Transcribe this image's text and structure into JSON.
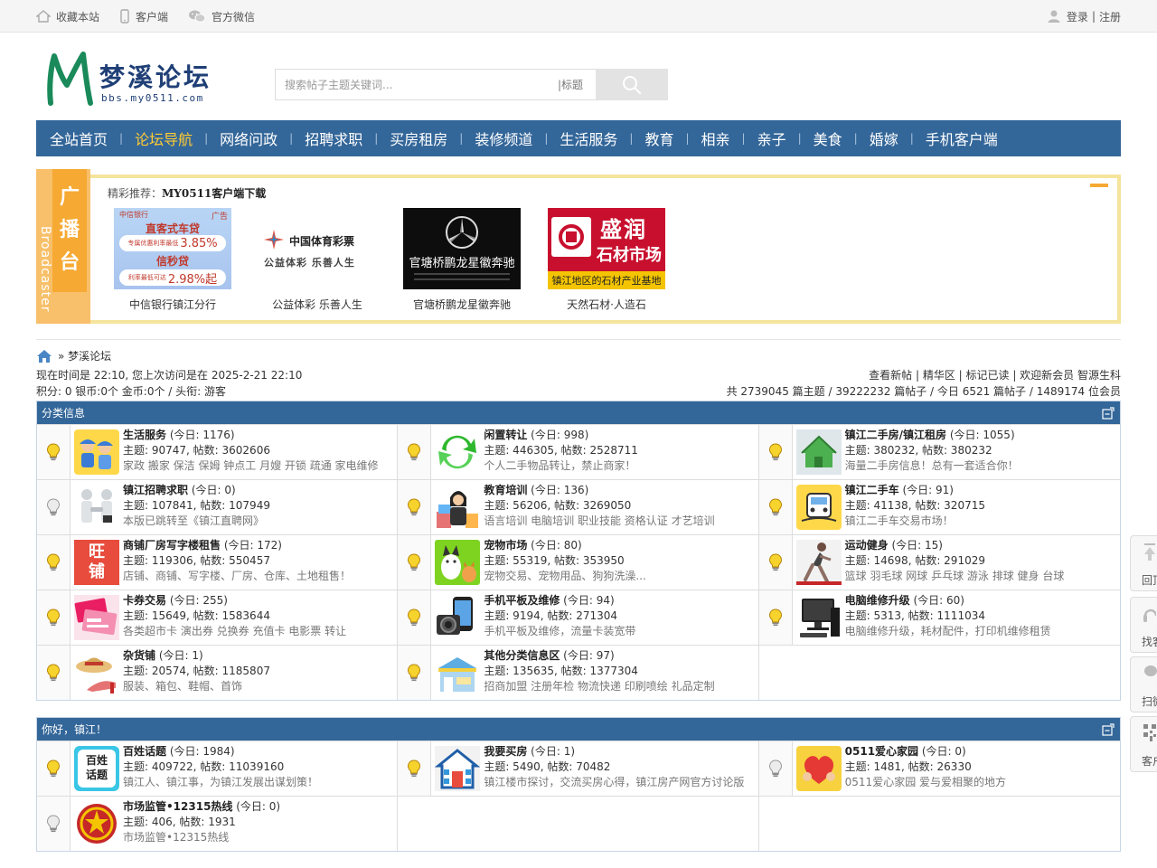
{
  "topbar": {
    "favorite": "收藏本站",
    "client": "客户端",
    "wechat": "官方微信",
    "login": "登录",
    "sep": "|",
    "register": "注册"
  },
  "header": {
    "logo_title": "梦溪论坛",
    "logo_sub": "bbs.my0511.com",
    "search_placeholder": "搜索帖子主题关键词...",
    "search_type": "|标题"
  },
  "nav": {
    "items": [
      "全站首页",
      "论坛导航",
      "网络问政",
      "招聘求职",
      "买房租房",
      "装修频道",
      "生活服务",
      "教育",
      "相亲",
      "亲子",
      "美食",
      "婚嫁",
      "手机客户端"
    ],
    "sep": "|"
  },
  "broadcaster": {
    "tab": [
      "广",
      "播",
      "台"
    ],
    "tab_vertical": "Broadcaster",
    "label": "精彩推荐：",
    "title": "MY0511客户端下载",
    "cards": [
      {
        "caption": "中信银行镇江分行",
        "bank": "中信银行",
        "tag": "广告",
        "line1": "直客式车贷",
        "line2a": "专属优惠利率最低",
        "line2b": "3.85%",
        "line3": "信秒贷",
        "line4a": "利率最低可达",
        "line4b": "2.98%起"
      },
      {
        "caption": "公益体彩 乐善人生",
        "name": "中国体育彩票",
        "slogan": "公益体彩 乐善人生"
      },
      {
        "caption": "官塘桥鹏龙星徽奔驰",
        "name": "官塘桥鹏龙星徽奔驰"
      },
      {
        "caption": "天然石材·人造石",
        "name1": "盛润",
        "name2": "石材市场",
        "banner": "镇江地区的石材产业基地"
      }
    ]
  },
  "breadcrumb": {
    "text": "» 梦溪论坛"
  },
  "info": {
    "line1_left": "现在时间是 22:10, 您上次访问是在 2025-2-21 22:10",
    "line2_left": "积分: 0 银币:0个 金币:0个 / 头衔: 游客",
    "line1_right": "查看新帖 | 精华区 | 标记已读 | 欢迎新会员 智源生科",
    "line2_right": "共 2739045 篇主题 / 39222232 篇帖子 / 今日 6521 篇帖子 / 1489174 位会员"
  },
  "sections": [
    {
      "title": "分类信息",
      "rows": [
        [
          {
            "name": "生活服务",
            "today": " (今日: 1176)",
            "stat": "主题: 90747, 帖数: 3602606",
            "desc": "家政 搬家 保洁 保姆 钟点工 月嫂 开锁 疏通 家电维修",
            "icon": "workers-icon",
            "new": true
          },
          {
            "name": "闲置转让",
            "today": " (今日: 998)",
            "stat": "主题: 446305, 帖数: 2528711",
            "desc": "个人二手物品转让，禁止商家！",
            "icon": "recycle-icon",
            "new": true
          },
          {
            "name": "镇江二手房/镇江租房",
            "today": " (今日: 1055)",
            "stat": "主题: 380232, 帖数: 380232",
            "desc": "海量二手房信息！总有一套适合你！",
            "icon": "green-house-icon",
            "new": true
          }
        ],
        [
          {
            "name": "镇江招聘求职",
            "today": " (今日: 0)",
            "stat": "主题: 107841, 帖数: 107949",
            "desc": "本版已跳转至《镇江直聘网》",
            "icon": "handshake-icon",
            "new": false
          },
          {
            "name": "教育培训",
            "today": " (今日: 136)",
            "stat": "主题: 56206, 帖数: 3269050",
            "desc": "语言培训 电脑培训 职业技能 资格认证 才艺培训",
            "icon": "teacher-icon",
            "new": true
          },
          {
            "name": "镇江二手车",
            "today": " (今日: 91)",
            "stat": "主题: 41138, 帖数: 320715",
            "desc": "镇江二手车交易市场！",
            "icon": "car-icon",
            "new": true
          }
        ],
        [
          {
            "name": "商铺厂房写字楼租售",
            "today": " (今日: 172)",
            "stat": "主题: 119306, 帖数: 550457",
            "desc": "店铺、商铺、写字楼、厂房、仓库、土地租售！",
            "icon": "shop-icon",
            "new": true,
            "icon_text": [
              "旺",
              "铺"
            ]
          },
          {
            "name": "宠物市场",
            "today": " (今日: 80)",
            "stat": "主题: 55319, 帖数: 353950",
            "desc": "宠物交易、宠物用品、狗狗洗澡...",
            "icon": "pets-icon",
            "new": true
          },
          {
            "name": "运动健身",
            "today": " (今日: 15)",
            "stat": "主题: 14698, 帖数: 291029",
            "desc": "篮球 羽毛球 网球 乒乓球 游泳 排球 健身 台球",
            "icon": "runner-icon",
            "new": true
          }
        ],
        [
          {
            "name": "卡券交易",
            "today": " (今日: 255)",
            "stat": "主题: 15649, 帖数: 1583644",
            "desc": "各类超市卡 演出券 兑换券 充值卡 电影票 转让",
            "icon": "coupon-icon",
            "new": true
          },
          {
            "name": "手机平板及维修",
            "today": " (今日: 94)",
            "stat": "主题: 9194, 帖数: 271304",
            "desc": "手机平板及维修，流量卡装宽带",
            "icon": "phone-camera-icon",
            "new": true
          },
          {
            "name": "电脑维修升级",
            "today": " (今日: 60)",
            "stat": "主题: 5313, 帖数: 1111034",
            "desc": "电脑维修升级，耗材配件，打印机维修租赁",
            "icon": "computer-icon",
            "new": true
          }
        ],
        [
          {
            "name": "杂货铺",
            "today": " (今日: 1)",
            "stat": "主题: 20574, 帖数: 1185807",
            "desc": "服装、箱包、鞋帽、首饰",
            "icon": "hat-shoe-icon",
            "new": true
          },
          {
            "name": "其他分类信息区",
            "today": " (今日: 97)",
            "stat": "主题: 135635, 帖数: 1377304",
            "desc": "招商加盟 注册年检 物流快递 印刷喷绘 礼品定制",
            "icon": "store-icon",
            "new": true
          },
          null
        ]
      ]
    },
    {
      "title": "你好，镇江！",
      "rows": [
        [
          {
            "name": "百姓话题",
            "today": " (今日: 1984)",
            "stat": "主题: 409722, 帖数: 11039160",
            "desc": "镇江人、镇江事，为镇江发展出谋划策！",
            "icon": "topic-badge-icon",
            "new": true,
            "icon_text": [
              "百姓",
              "话题"
            ]
          },
          {
            "name": "我要买房",
            "today": " (今日: 1)",
            "stat": "主题: 5490, 帖数: 70482",
            "desc": "镇江楼市探讨，交流买房心得，镇江房产网官方讨论版",
            "icon": "house-icon",
            "new": true
          },
          {
            "name": "0511爱心家园",
            "today": " (今日: 0)",
            "stat": "主题: 1481, 帖数: 26330",
            "desc": "0511爱心家园    爱与爱相聚的地方",
            "icon": "heart-icon",
            "new": false
          }
        ],
        [
          {
            "name": "市场监管•12315热线",
            "today": " (今日: 0)",
            "stat": "主题: 406, 帖数: 1931",
            "desc": "市场监管•12315热线",
            "icon": "emblem-icon",
            "new": false
          },
          null,
          null
        ]
      ]
    }
  ],
  "right_float": [
    {
      "label": "回顶",
      "icon": "top-icon"
    },
    {
      "label": "找客",
      "icon": "service-icon"
    },
    {
      "label": "扫微",
      "icon": "wechat-icon"
    },
    {
      "label": "客户",
      "icon": "qrcode-icon"
    }
  ],
  "colors": {
    "nav_bg": "#336699",
    "nav_active": "#ffcc33",
    "broadcaster_border": "#f5e49b",
    "broadcaster_tab": "#f6a933"
  }
}
